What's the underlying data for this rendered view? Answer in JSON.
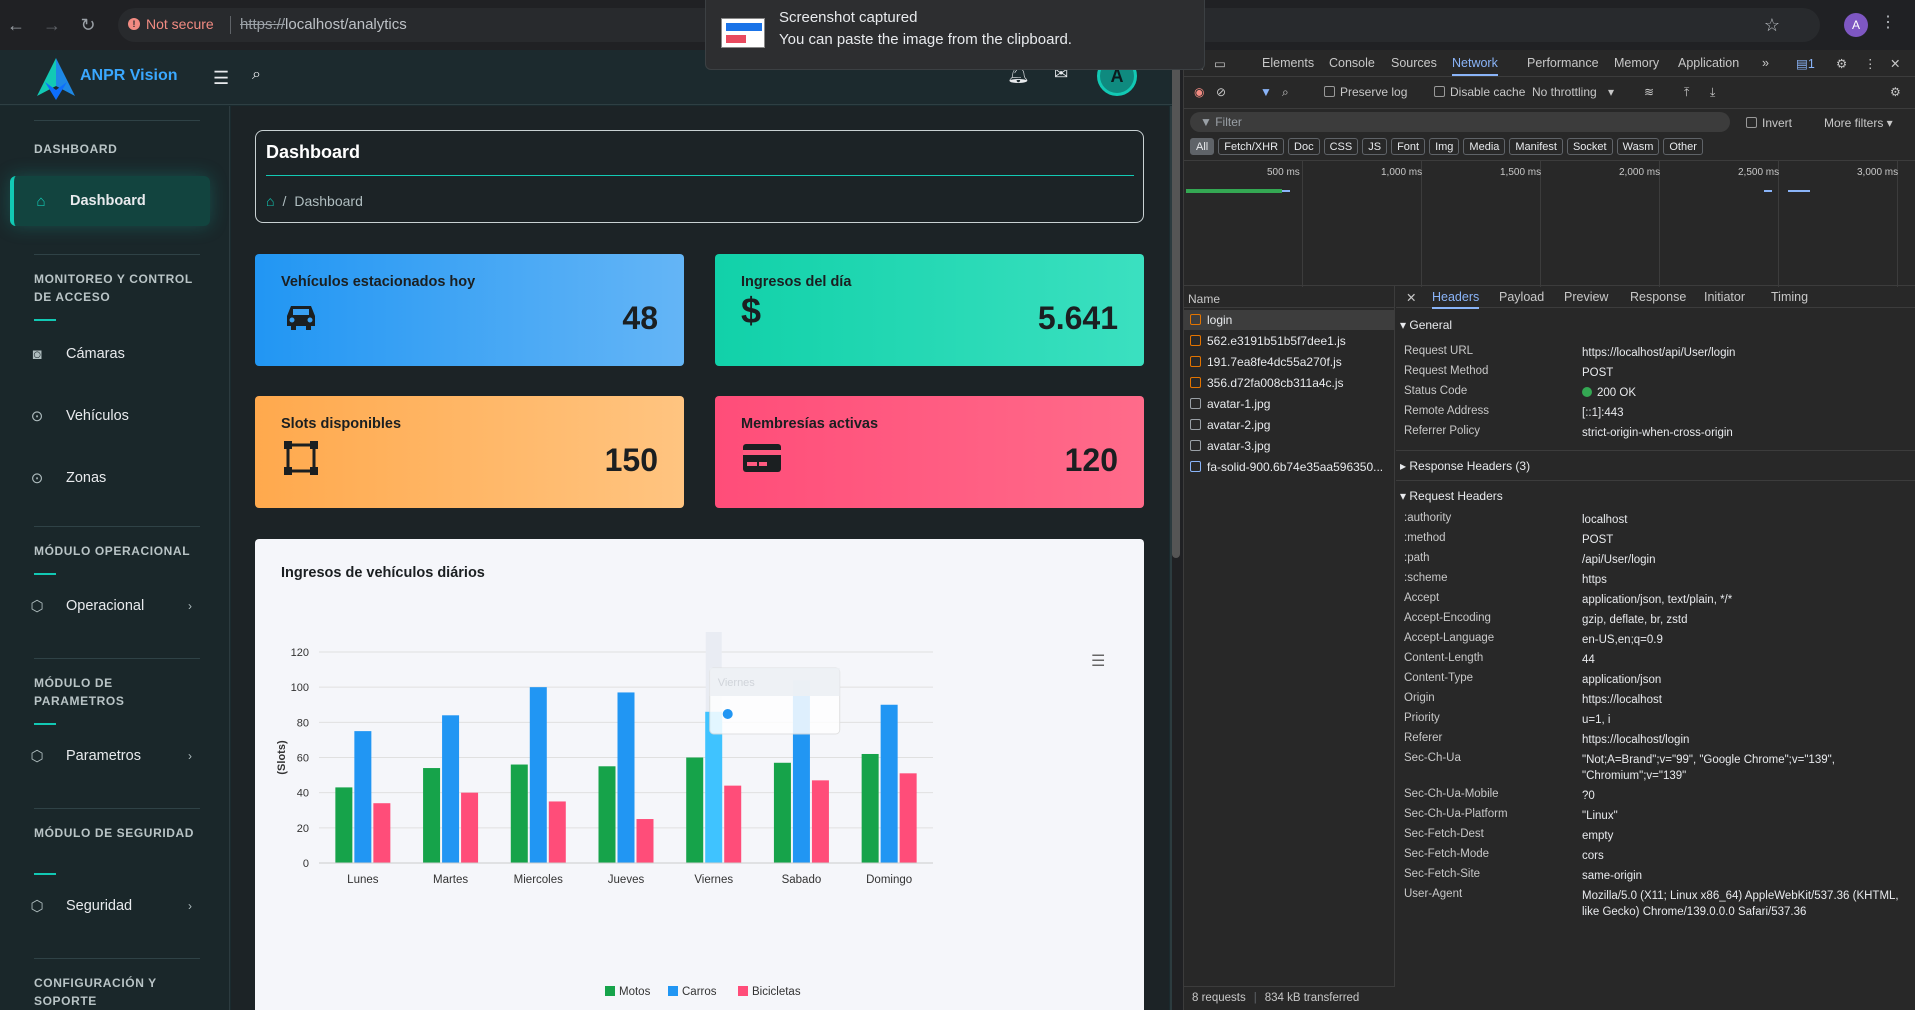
{
  "browser": {
    "not_secure": "Not secure",
    "url_scheme": "https://",
    "url_rest": "localhost/analytics",
    "profile_initial": "A"
  },
  "toast": {
    "title": "Screenshot captured",
    "message": "You can paste the image from the clipboard."
  },
  "app": {
    "brand": "ANPR Vision",
    "avatar_initial": "A"
  },
  "sidebar": {
    "section_dashboard": "DASHBOARD",
    "item_dashboard": "Dashboard",
    "section_monitoreo": "MONITOREO Y CONTROL DE ACCESO",
    "item_camaras": "Cámaras",
    "item_vehiculos": "Vehículos",
    "item_zonas": "Zonas",
    "section_operacional": "MÓDULO OPERACIONAL",
    "item_operacional": "Operacional",
    "section_parametros": "MÓDULO DE PARAMETROS",
    "item_parametros": "Parametros",
    "section_seguridad": "MÓDULO DE SEGURIDAD",
    "item_seguridad": "Seguridad",
    "section_config": "CONFIGURACIÓN Y SOPORTE"
  },
  "page": {
    "title": "Dashboard",
    "breadcrumb": "Dashboard"
  },
  "cards": [
    {
      "label": "Vehículos estacionados hoy",
      "value": "48",
      "icon": "car-icon"
    },
    {
      "label": "Ingresos del día",
      "value": "5.641",
      "icon": "dollar-icon"
    },
    {
      "label": "Slots disponibles",
      "value": "150",
      "icon": "vector-square-icon"
    },
    {
      "label": "Membresías activas",
      "value": "120",
      "icon": "credit-card-icon"
    }
  ],
  "chart_data": {
    "type": "bar",
    "title": "Ingresos de vehículos diários",
    "ylabel": "(Slots)",
    "xlabel": "",
    "ylim": [
      0,
      120
    ],
    "yticks": [
      0,
      20,
      40,
      60,
      80,
      100,
      120
    ],
    "categories": [
      "Lunes",
      "Martes",
      "Miercoles",
      "Jueves",
      "Viernes",
      "Sabado",
      "Domingo"
    ],
    "series": [
      {
        "name": "Motos",
        "color": "#16a34a",
        "values": [
          43,
          54,
          56,
          55,
          60,
          57,
          62
        ]
      },
      {
        "name": "Carros",
        "color": "#2196f3",
        "values": [
          75,
          84,
          100,
          97,
          86,
          104,
          90
        ]
      },
      {
        "name": "Bicicletas",
        "color": "#ff4d79",
        "values": [
          34,
          40,
          35,
          25,
          44,
          47,
          51
        ]
      }
    ],
    "legend": "bottom",
    "tooltip_category": "Viernes",
    "highlight_category": "Viernes"
  },
  "devtools": {
    "tabs": [
      "Elements",
      "Console",
      "Sources",
      "Network",
      "Performance",
      "Memory",
      "Application"
    ],
    "selected_tab": "Network",
    "issues_count": "1",
    "preserve_log": "Preserve log",
    "disable_cache": "Disable cache",
    "throttling": "No throttling",
    "filter_placeholder": "Filter",
    "invert": "Invert",
    "more_filters": "More filters",
    "chips": [
      "All",
      "Fetch/XHR",
      "Doc",
      "CSS",
      "JS",
      "Font",
      "Img",
      "Media",
      "Manifest",
      "Socket",
      "Wasm",
      "Other"
    ],
    "timeline_ticks": [
      "500 ms",
      "1,000 ms",
      "1,500 ms",
      "2,000 ms",
      "2,500 ms",
      "3,000 ms"
    ],
    "name_header": "Name",
    "requests": [
      "login",
      "562.e3191b51b5f7dee1.js",
      "191.7ea8fe4dc55a270f.js",
      "356.d72fa008cb311a4c.js",
      "avatar-1.jpg",
      "avatar-2.jpg",
      "avatar-3.jpg",
      "fa-solid-900.6b74e35aa596350..."
    ],
    "status_requests": "8 requests",
    "status_transferred": "834 kB transferred",
    "detail_tabs": [
      "Headers",
      "Payload",
      "Preview",
      "Response",
      "Initiator",
      "Timing"
    ],
    "general_title": "General",
    "general": [
      {
        "k": "Request URL",
        "v": "https://localhost/api/User/login"
      },
      {
        "k": "Request Method",
        "v": "POST"
      },
      {
        "k": "Status Code",
        "v": "200 OK"
      },
      {
        "k": "Remote Address",
        "v": "[::1]:443"
      },
      {
        "k": "Referrer Policy",
        "v": "strict-origin-when-cross-origin"
      }
    ],
    "response_headers_title": "Response Headers (3)",
    "request_headers_title": "Request Headers",
    "request_headers": [
      {
        "k": ":authority",
        "v": "localhost"
      },
      {
        "k": ":method",
        "v": "POST"
      },
      {
        "k": ":path",
        "v": "/api/User/login"
      },
      {
        "k": ":scheme",
        "v": "https"
      },
      {
        "k": "Accept",
        "v": "application/json, text/plain, */*"
      },
      {
        "k": "Accept-Encoding",
        "v": "gzip, deflate, br, zstd"
      },
      {
        "k": "Accept-Language",
        "v": "en-US,en;q=0.9"
      },
      {
        "k": "Content-Length",
        "v": "44"
      },
      {
        "k": "Content-Type",
        "v": "application/json"
      },
      {
        "k": "Origin",
        "v": "https://localhost"
      },
      {
        "k": "Priority",
        "v": "u=1, i"
      },
      {
        "k": "Referer",
        "v": "https://localhost/login"
      },
      {
        "k": "Sec-Ch-Ua",
        "v": "\"Not;A=Brand\";v=\"99\", \"Google Chrome\";v=\"139\", \"Chromium\";v=\"139\""
      },
      {
        "k": "Sec-Ch-Ua-Mobile",
        "v": "?0"
      },
      {
        "k": "Sec-Ch-Ua-Platform",
        "v": "\"Linux\""
      },
      {
        "k": "Sec-Fetch-Dest",
        "v": "empty"
      },
      {
        "k": "Sec-Fetch-Mode",
        "v": "cors"
      },
      {
        "k": "Sec-Fetch-Site",
        "v": "same-origin"
      },
      {
        "k": "User-Agent",
        "v": "Mozilla/5.0 (X11; Linux x86_64) AppleWebKit/537.36 (KHTML, like Gecko) Chrome/139.0.0.0 Safari/537.36"
      }
    ]
  }
}
